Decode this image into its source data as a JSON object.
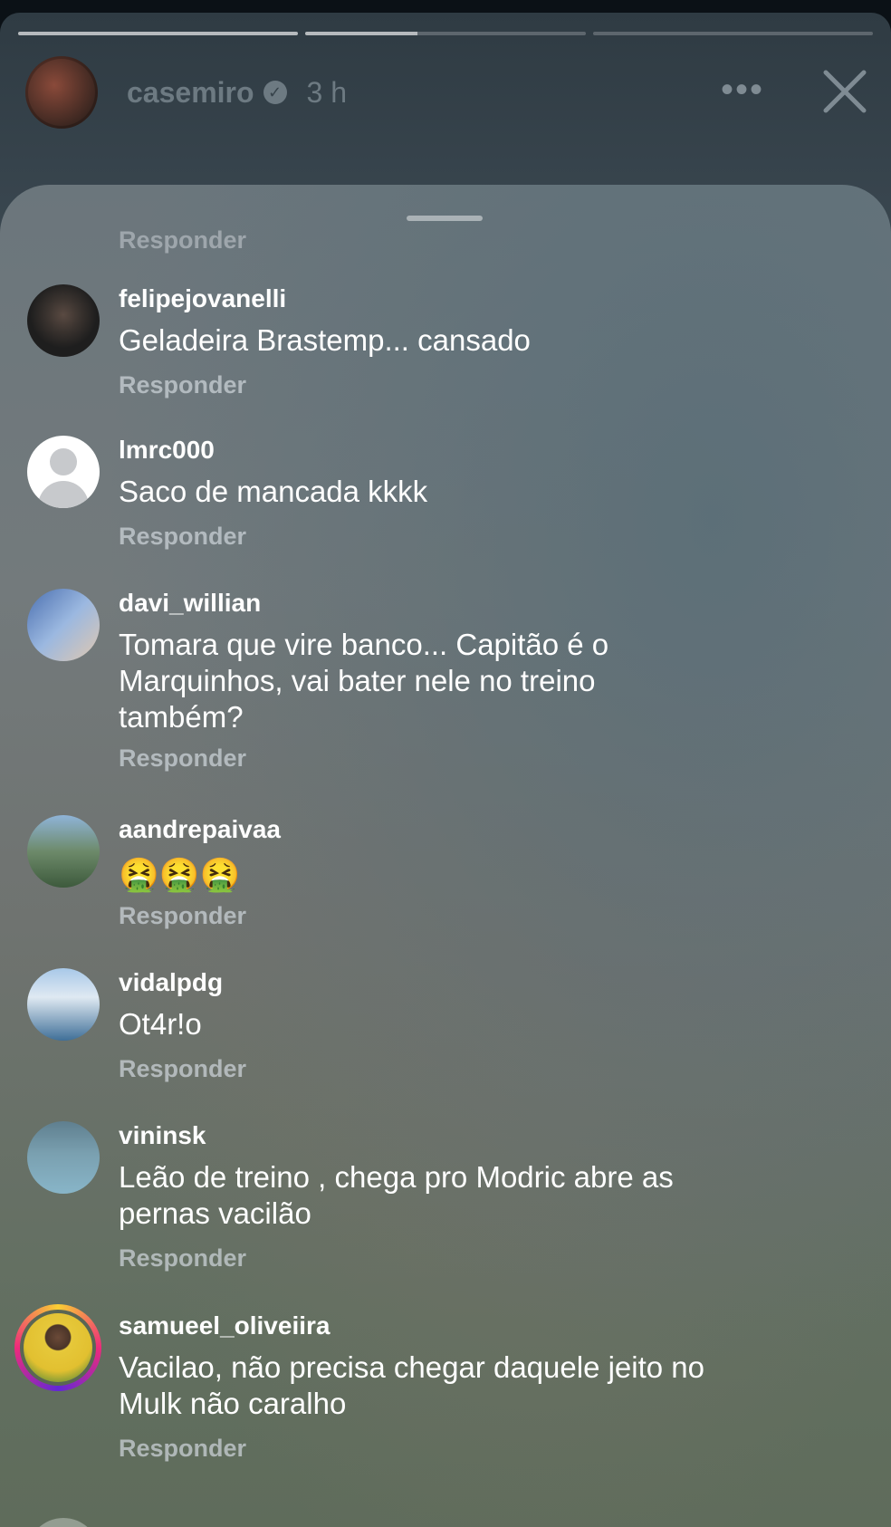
{
  "story": {
    "progress": [
      1.0,
      0.4,
      0.0
    ],
    "username": "casemiro",
    "time": "3 h",
    "more_icon": "more-horizontal-icon",
    "close_icon": "close-icon"
  },
  "comments_sheet": {
    "previous_reply_label": "Responder",
    "comments": [
      {
        "username": "felipejovanelli",
        "text": "Geladeira Brastemp... cansado",
        "reply": "Responder"
      },
      {
        "username": "lmrc000",
        "text": "Saco de mancada kkkk",
        "reply": "Responder"
      },
      {
        "username": "davi_willian",
        "text": "Tomara que vire banco... Capitão é o Marquinhos, vai bater nele no treino também?",
        "reply": "Responder"
      },
      {
        "username": "aandrepaivaa",
        "text": "🤮🤮🤮",
        "reply": "Responder"
      },
      {
        "username": "vidalpdg",
        "text": "Ot4r!o",
        "reply": "Responder"
      },
      {
        "username": "vininsk",
        "text": "Leão de treino , chega pro Modric abre as pernas vacilão",
        "reply": "Responder"
      },
      {
        "username": "samueel_oliveiira",
        "text": "Vacilao, não precisa chegar daquele jeito no Mulk não caralho",
        "reply": "Responder"
      }
    ]
  }
}
